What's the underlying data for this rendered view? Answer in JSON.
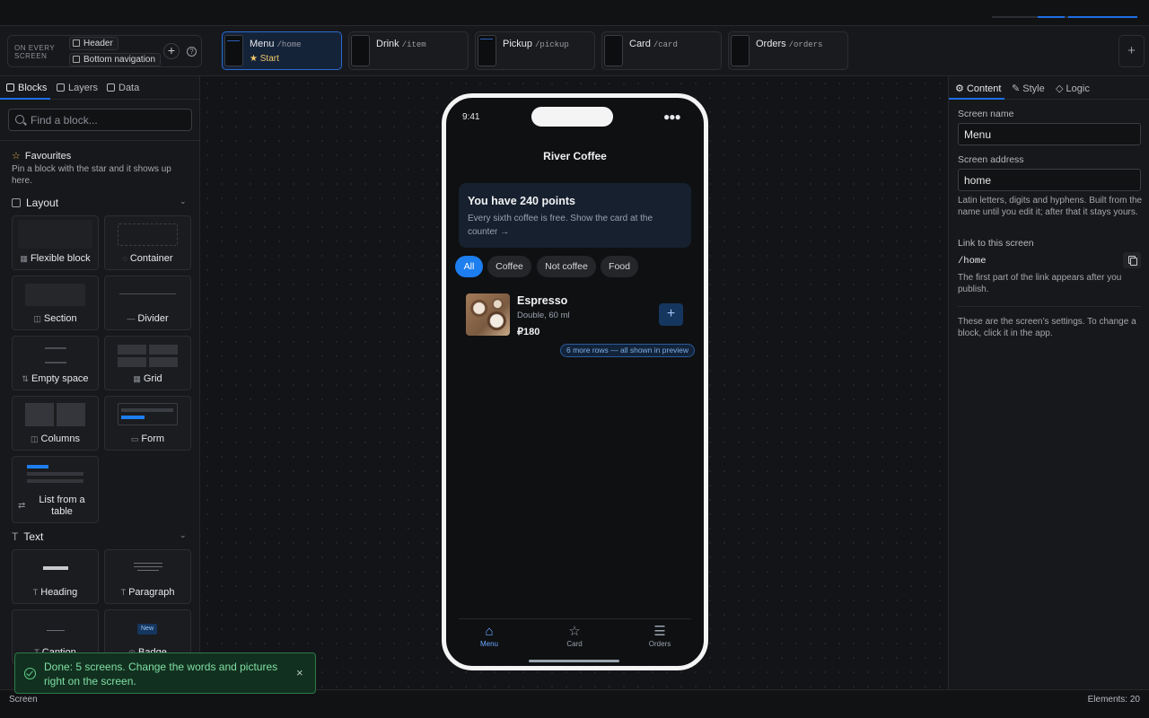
{
  "every_screen": {
    "label": "ON EVERY SCREEN",
    "chips": [
      "Header",
      "Bottom navigation"
    ],
    "add_label": "+",
    "help_label": "?"
  },
  "screens": [
    {
      "name": "Menu",
      "path": "/home",
      "start": "Start"
    },
    {
      "name": "Drink",
      "path": "/item"
    },
    {
      "name": "Pickup",
      "path": "/pickup"
    },
    {
      "name": "Card",
      "path": "/card"
    },
    {
      "name": "Orders",
      "path": "/orders"
    }
  ],
  "add_screen_label": "+",
  "left_panel": {
    "tabs": [
      {
        "label": "Blocks",
        "icon": "blocks-icon"
      },
      {
        "label": "Layers",
        "icon": "layers-icon"
      },
      {
        "label": "Data",
        "icon": "data-icon"
      }
    ],
    "search_placeholder": "Find a block...",
    "favourites_title": "Favourites",
    "favourites_desc": "Pin a block with the star and it shows up here.",
    "sections": [
      {
        "title": "Layout",
        "blocks": [
          "Flexible block",
          "Container",
          "Section",
          "Divider",
          "Empty space",
          "Grid",
          "Columns",
          "Form",
          "List from a table"
        ]
      },
      {
        "title": "Text",
        "blocks": [
          "Heading",
          "Paragraph",
          "Caption",
          "Badge"
        ]
      }
    ],
    "badge_preview": "New"
  },
  "phone": {
    "time": "9:41",
    "title": "River Coffee",
    "points_title": "You have 240 points",
    "points_desc": "Every sixth coffee is free. Show the card at the counter →",
    "chips": [
      "All",
      "Coffee",
      "Not coffee",
      "Food"
    ],
    "active_chip": "All",
    "item": {
      "name": "Espresso",
      "desc": "Double, 60 ml",
      "price": "₽180",
      "add": "+"
    },
    "more_rows": "6 more rows — all shown in preview",
    "nav": [
      {
        "label": "Menu",
        "icon": "home-icon",
        "active": true
      },
      {
        "label": "Card",
        "icon": "star-icon",
        "active": false
      },
      {
        "label": "Orders",
        "icon": "list-icon",
        "active": false
      }
    ]
  },
  "right_panel": {
    "tabs": [
      "Content",
      "Style",
      "Logic"
    ],
    "screen_name_label": "Screen name",
    "screen_name_value": "Menu",
    "screen_address_label": "Screen address",
    "screen_address_value": "home",
    "address_help": "Latin letters, digits and hyphens. Built from the name until you edit it; after that it stays yours.",
    "link_label": "Link to this screen",
    "link_value": "/home",
    "link_help": "The first part of the link appears after you publish.",
    "settings_note": "These are the screen’s settings. To change a block, click it in the app."
  },
  "toast": {
    "message": "Done: 5 screens. Change the words and pictures right on the screen.",
    "close": "×"
  },
  "status_bar": {
    "left": "Screen",
    "right": "Elements: 20"
  },
  "colors": {
    "accent": "#1d6ee6",
    "success": "#5fd08c",
    "phone_frame": "#f4f4f5",
    "star": "#e6b64a"
  }
}
